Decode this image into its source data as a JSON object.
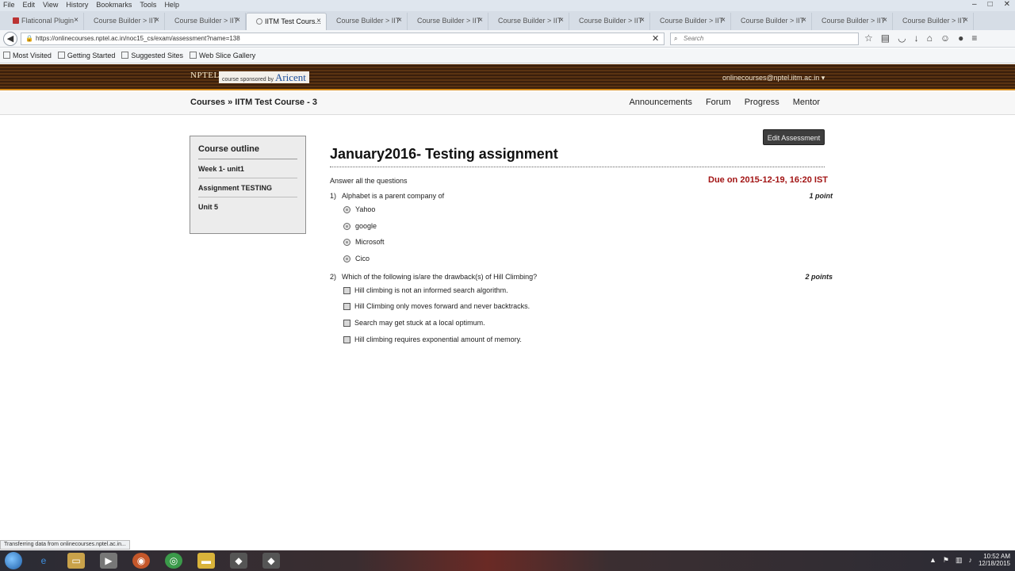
{
  "browser": {
    "menu": [
      "File",
      "Edit",
      "View",
      "History",
      "Bookmarks",
      "Tools",
      "Help"
    ],
    "tabs": [
      {
        "label": "Flaticonal Plugin",
        "active": false
      },
      {
        "label": "Course Builder > IIT",
        "active": false
      },
      {
        "label": "Course Builder > IIT",
        "active": false
      },
      {
        "label": "IITM Test Cours...",
        "active": true
      },
      {
        "label": "Course Builder > IIT",
        "active": false
      },
      {
        "label": "Course Builder > IIT",
        "active": false
      },
      {
        "label": "Course Builder > IIT",
        "active": false
      },
      {
        "label": "Course Builder > IIT",
        "active": false
      },
      {
        "label": "Course Builder > IIT",
        "active": false
      },
      {
        "label": "Course Builder > IIT",
        "active": false
      },
      {
        "label": "Course Builder > IIT",
        "active": false
      },
      {
        "label": "Course Builder > IIT",
        "active": false
      }
    ],
    "url": "https://onlinecourses.nptel.ac.in/noc15_cs/exam/assessment?name=138",
    "search_placeholder": "Search",
    "bookmarks": [
      "Most Visited",
      "Getting Started",
      "Suggested Sites",
      "Web Slice Gallery"
    ],
    "status_tip": "Transferring data from onlinecourses.nptel.ac.in..."
  },
  "site": {
    "logo": "NPTEL",
    "sponsor_prefix": "course sponsored by",
    "sponsor_brand": "Aricent",
    "user_email": "onlinecourses@nptel.iitm.ac.in ▾"
  },
  "course_nav": {
    "breadcrumb": "Courses » IITM Test Course - 3",
    "links": [
      "Announcements",
      "Forum",
      "Progress",
      "Mentor"
    ]
  },
  "outline": {
    "title": "Course outline",
    "items": [
      "Week 1- unit1",
      "Assignment TESTING",
      "Unit 5"
    ]
  },
  "assessment": {
    "edit_label": "Edit Assessment",
    "title": "January2016- Testing assignment",
    "instructions": "Answer all the questions",
    "due": "Due on 2015-12-19, 16:20 IST",
    "questions": [
      {
        "num": "1)",
        "text": "Alphabet is a parent company of",
        "points": "1 point",
        "options": [
          "Yahoo",
          "google",
          "Microsoft",
          "Cico"
        ]
      },
      {
        "num": "2)",
        "text": "Which of the following is/are the drawback(s) of Hill Climbing?",
        "points": "2 points",
        "options": [
          "Hill climbing is not an informed search algorithm.",
          "Hill Climbing only moves forward and never backtracks.",
          "Search may get stuck at a local optimum.",
          "Hill climbing requires exponential amount of memory."
        ]
      }
    ]
  },
  "taskbar": {
    "time": "10:52 AM",
    "date": "12/18/2015"
  }
}
